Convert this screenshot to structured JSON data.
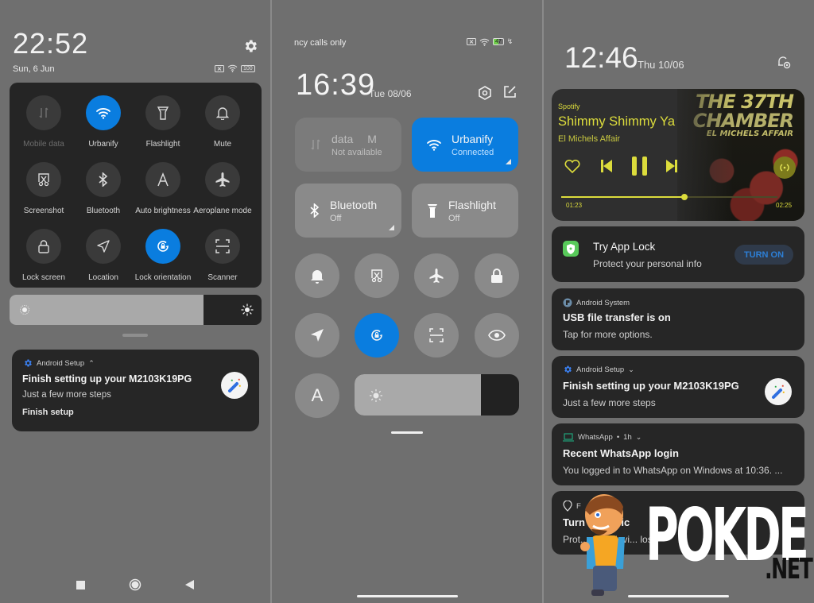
{
  "panel1": {
    "clock": "22:52",
    "date": "Sun, 6 Jun",
    "status": {
      "sim": "no-sim-icon",
      "wifi": "wifi-icon",
      "battery": "100"
    },
    "quick_settings": [
      {
        "label": "Mobile data",
        "icon": "mobile-data-icon",
        "active": false,
        "disabled": true
      },
      {
        "label": "Urbanify",
        "icon": "wifi-icon",
        "active": true,
        "disabled": false
      },
      {
        "label": "Flashlight",
        "icon": "flashlight-icon",
        "active": false,
        "disabled": false
      },
      {
        "label": "Mute",
        "icon": "bell-icon",
        "active": false,
        "disabled": false
      },
      {
        "label": "Screenshot",
        "icon": "screenshot-icon",
        "active": false,
        "disabled": false
      },
      {
        "label": "Bluetooth",
        "icon": "bluetooth-icon",
        "active": false,
        "disabled": false
      },
      {
        "label": "Auto brightness",
        "icon": "auto-brightness-icon",
        "active": false,
        "disabled": false
      },
      {
        "label": "Aeroplane mode",
        "icon": "airplane-icon",
        "active": false,
        "disabled": false
      },
      {
        "label": "Lock screen",
        "icon": "lock-icon",
        "active": false,
        "disabled": false
      },
      {
        "label": "Location",
        "icon": "location-icon",
        "active": false,
        "disabled": false
      },
      {
        "label": "Lock orientation",
        "icon": "rotation-lock-icon",
        "active": true,
        "disabled": false
      },
      {
        "label": "Scanner",
        "icon": "scanner-icon",
        "active": false,
        "disabled": false
      }
    ],
    "brightness_fraction": 0.77,
    "notification": {
      "app": "Android Setup",
      "title": "Finish setting up your M2103K19PG",
      "body": "Just a few more steps",
      "action": "Finish setup"
    }
  },
  "panel2": {
    "carrier": "ncy calls only",
    "battery": "47",
    "clock": "16:39",
    "date": "Tue 08/06",
    "big_tiles": [
      {
        "title": "data",
        "title_suffix": "M",
        "subtitle": "Not available",
        "icon": "mobile-data-icon",
        "state": "disabled"
      },
      {
        "title": "Urbanify",
        "subtitle": "Connected",
        "icon": "wifi-icon",
        "state": "on"
      },
      {
        "title": "Bluetooth",
        "subtitle": "Off",
        "icon": "bluetooth-icon",
        "state": "off"
      },
      {
        "title": "Flashlight",
        "subtitle": "Off",
        "icon": "flashlight-icon",
        "state": "off"
      }
    ],
    "round_tiles": [
      {
        "icon": "bell-icon",
        "active": false
      },
      {
        "icon": "screenshot-icon",
        "active": false
      },
      {
        "icon": "airplane-icon",
        "active": false
      },
      {
        "icon": "lock-icon",
        "active": false
      },
      {
        "icon": "location-icon",
        "active": false
      },
      {
        "icon": "rotation-lock-icon",
        "active": true
      },
      {
        "icon": "scanner-icon",
        "active": false
      },
      {
        "icon": "eye-icon",
        "active": false
      },
      {
        "icon": "auto-brightness-icon",
        "active": false
      }
    ],
    "auto_brightness_label": "A",
    "brightness_fraction": 0.77
  },
  "panel3": {
    "clock": "12:46",
    "date": "Thu 10/06",
    "media": {
      "app": "Spotify",
      "song": "Shimmy Shimmy Ya",
      "artist": "El Michels Affair",
      "current_time": "01:23",
      "total_time": "02:25",
      "progress_fraction": 0.57,
      "album_art_lines": [
        "THE 37TH",
        "CHAMBER",
        "EL MICHELS AFFAIR"
      ],
      "accent": "#dcdc3c"
    },
    "notifications": [
      {
        "title": "Try App Lock",
        "body": "Protect your personal info",
        "button": "TURN ON"
      },
      {
        "app": "Android System",
        "title": "USB file transfer is on",
        "body": "Tap for more options."
      },
      {
        "app": "Android Setup",
        "title": "Finish setting up your M2103K19PG",
        "body": "Just a few more steps"
      },
      {
        "app": "WhatsApp",
        "time": "1h",
        "title": "Recent WhatsApp login",
        "body": "You logged in to WhatsApp on Windows at 10:36. ..."
      },
      {
        "app": "F",
        "title": "Turn on devic",
        "body": "Prot... your devi... lost"
      }
    ]
  },
  "watermark": {
    "brand": "POKDE",
    "tld": ".NET"
  }
}
